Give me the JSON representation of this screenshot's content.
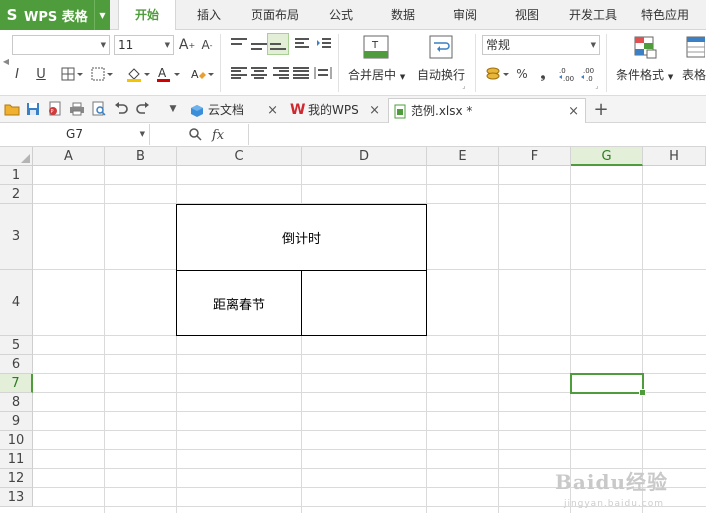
{
  "app": {
    "logo": "S",
    "title": "WPS 表格"
  },
  "menu": {
    "tabs": [
      "开始",
      "插入",
      "页面布局",
      "公式",
      "数据",
      "审阅",
      "视图",
      "开发工具",
      "特色应用"
    ],
    "active": "开始"
  },
  "ribbon": {
    "font_name": "",
    "font_size": "11",
    "merge_label": "合并居中",
    "wrap_label": "自动换行",
    "number_format": "常规",
    "cond_format_label": "条件格式",
    "table_label": "表格",
    "percent_symbol": "%",
    "comma_symbol": "❟"
  },
  "doc_tabs": [
    {
      "label": "云文档",
      "icon": "cloud-icon",
      "active": false
    },
    {
      "label": "我的WPS",
      "icon": "wps-icon",
      "active": false
    },
    {
      "label": "范例.xlsx *",
      "icon": "xlsx-file-icon",
      "active": true
    }
  ],
  "formula_bar": {
    "name_box": "G7",
    "fx_symbol": "fx",
    "value": ""
  },
  "sheet": {
    "columns": [
      "A",
      "B",
      "C",
      "D",
      "E",
      "F",
      "G",
      "H"
    ],
    "rows": [
      "1",
      "2",
      "3",
      "4",
      "5",
      "6",
      "7",
      "8",
      "9",
      "10",
      "11",
      "12",
      "13"
    ],
    "selected_column": "G",
    "selected_row": "7",
    "cells": {
      "C3": "倒计时",
      "C4": "距离春节",
      "D4": ""
    }
  },
  "watermark": {
    "brand": "Baidu经验",
    "url": "jingyan.baidu.com"
  },
  "colors": {
    "accent": "#4e9c3c",
    "header_bg": "#f2f2f2"
  }
}
